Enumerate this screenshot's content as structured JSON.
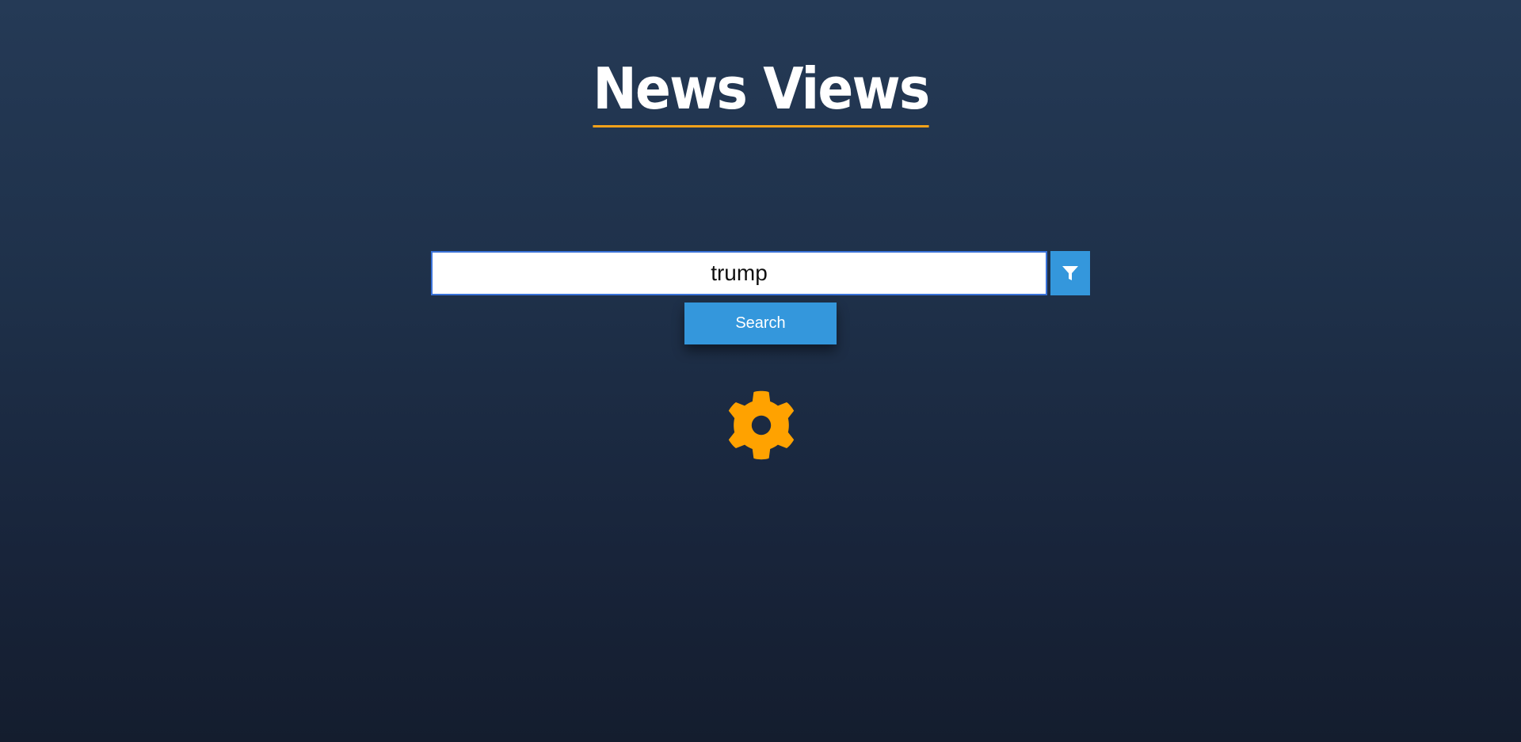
{
  "header": {
    "title": "News Views"
  },
  "search": {
    "value": "trump",
    "button_label": "Search",
    "filter_icon": "filter-icon"
  },
  "settings": {
    "icon": "gear-icon"
  },
  "colors": {
    "accent": "#f5a21a",
    "button_blue": "#3497dc",
    "background_top": "#253a56",
    "background_bottom": "#141d2e"
  }
}
